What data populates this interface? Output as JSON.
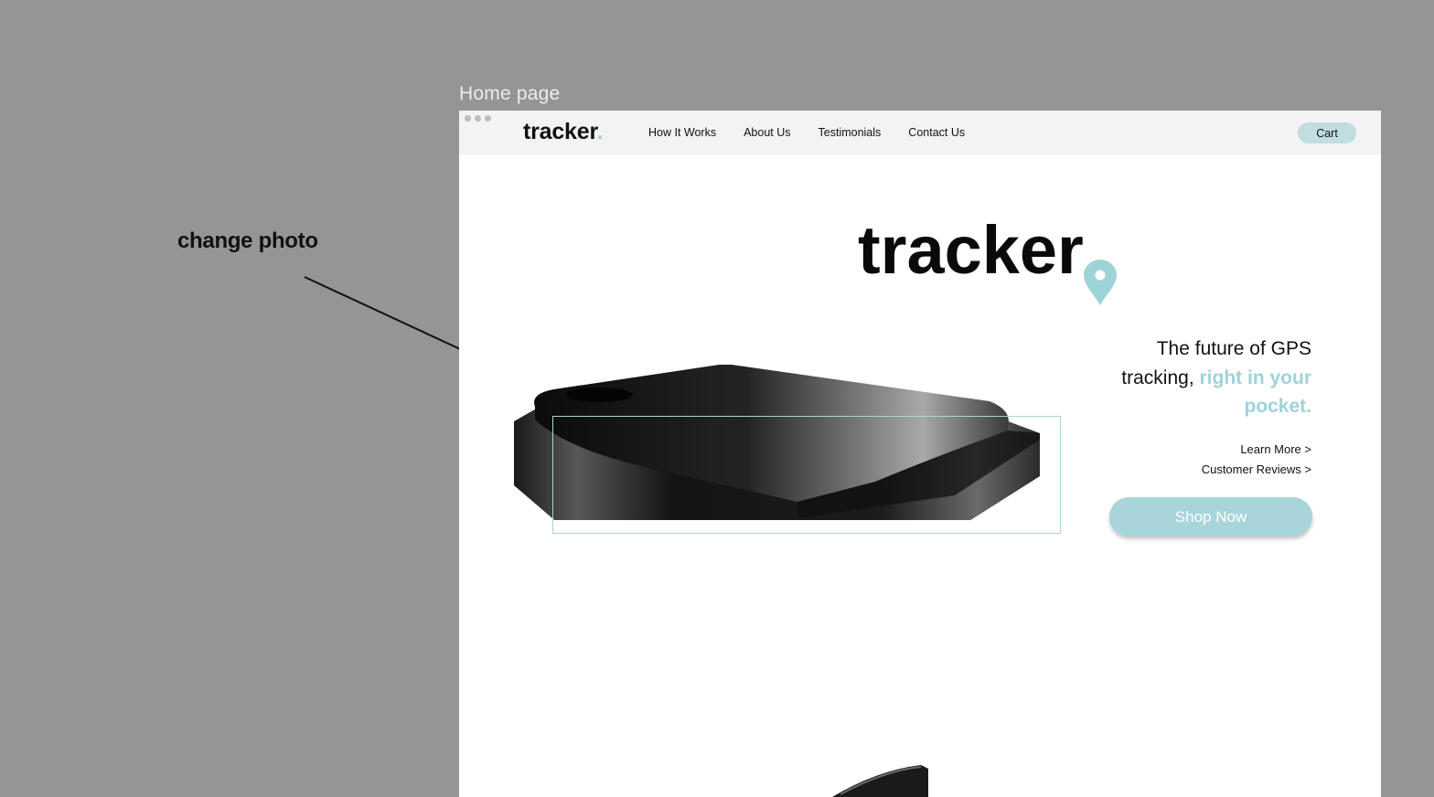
{
  "canvas": {
    "frame_label": "Home page",
    "annotation": "change photo"
  },
  "navbar": {
    "logo_text": "tracker",
    "logo_dot": ".",
    "links": [
      "How It Works",
      "About Us",
      "Testimonials",
      "Contact Us"
    ],
    "cart_label": "Cart"
  },
  "hero": {
    "brand": "tracker",
    "tagline_plain": "The future of GPS tracking, ",
    "tagline_accent": "right in your pocket.",
    "links": [
      "Learn More >",
      "Customer Reviews >"
    ],
    "shop_label": "Shop Now"
  },
  "colors": {
    "canvas_bg": "#959595",
    "accent": "#9ed3d9",
    "button": "#a7d5da",
    "cart_bg": "#c1dde0"
  },
  "icons": [
    "map-pin-icon",
    "window-dots-icon",
    "arrow-annotation-icon"
  ]
}
